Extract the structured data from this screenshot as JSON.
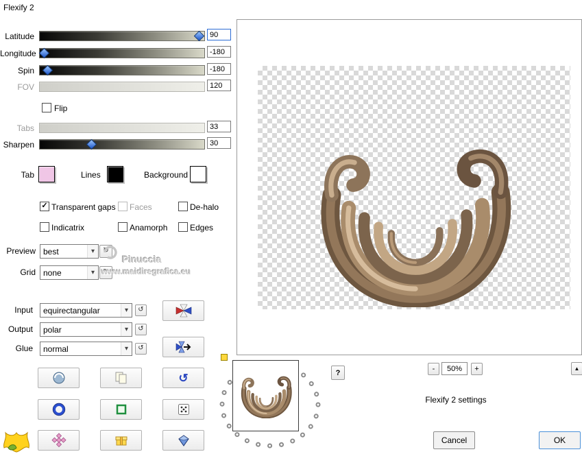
{
  "window": {
    "title": "Flexify 2"
  },
  "sliders": [
    {
      "label": "Latitude",
      "value": "90"
    },
    {
      "label": "Longitude",
      "value": "-180"
    },
    {
      "label": "Spin",
      "value": "-180"
    },
    {
      "label": "FOV",
      "value": "120"
    },
    {
      "label": "Tabs",
      "value": "33"
    },
    {
      "label": "Sharpen",
      "value": "30"
    }
  ],
  "flip": {
    "label": "Flip"
  },
  "swatches": [
    {
      "label": "Tab",
      "color": "#f0c6e6"
    },
    {
      "label": "Lines",
      "color": "#000000"
    },
    {
      "label": "Background",
      "color": "#ffffff"
    }
  ],
  "checkboxes": [
    {
      "label": "Transparent gaps"
    },
    {
      "label": "Faces"
    },
    {
      "label": "De-halo"
    },
    {
      "label": "Indicatrix"
    },
    {
      "label": "Anamorph"
    },
    {
      "label": "Edges"
    }
  ],
  "combos": [
    {
      "label": "Preview",
      "value": "best"
    },
    {
      "label": "Grid",
      "value": "none"
    },
    {
      "label": "Input",
      "value": "equirectangular"
    },
    {
      "label": "Output",
      "value": "polar"
    },
    {
      "label": "Glue",
      "value": "normal"
    }
  ],
  "icons": {
    "combo_arrow": "▾",
    "mini_revert": "↺",
    "revert": "↻",
    "undo": "↺",
    "check": "✓",
    "help": "?",
    "scroll_up": "▲",
    "zoom_minus": "-",
    "zoom_plus": "+"
  },
  "watermark": {
    "line1": "Pinuccia",
    "line2": "www.maidiregrafica.eu"
  },
  "zoom": {
    "value": "50%"
  },
  "status": {
    "text": "Flexify 2 settings"
  },
  "actions": {
    "cancel": "Cancel",
    "ok": "OK"
  },
  "colors": {
    "accent": "#0078d7",
    "tab_swatch": "#f0c6e6",
    "lines_swatch": "#000000",
    "background_swatch": "#ffffff"
  }
}
